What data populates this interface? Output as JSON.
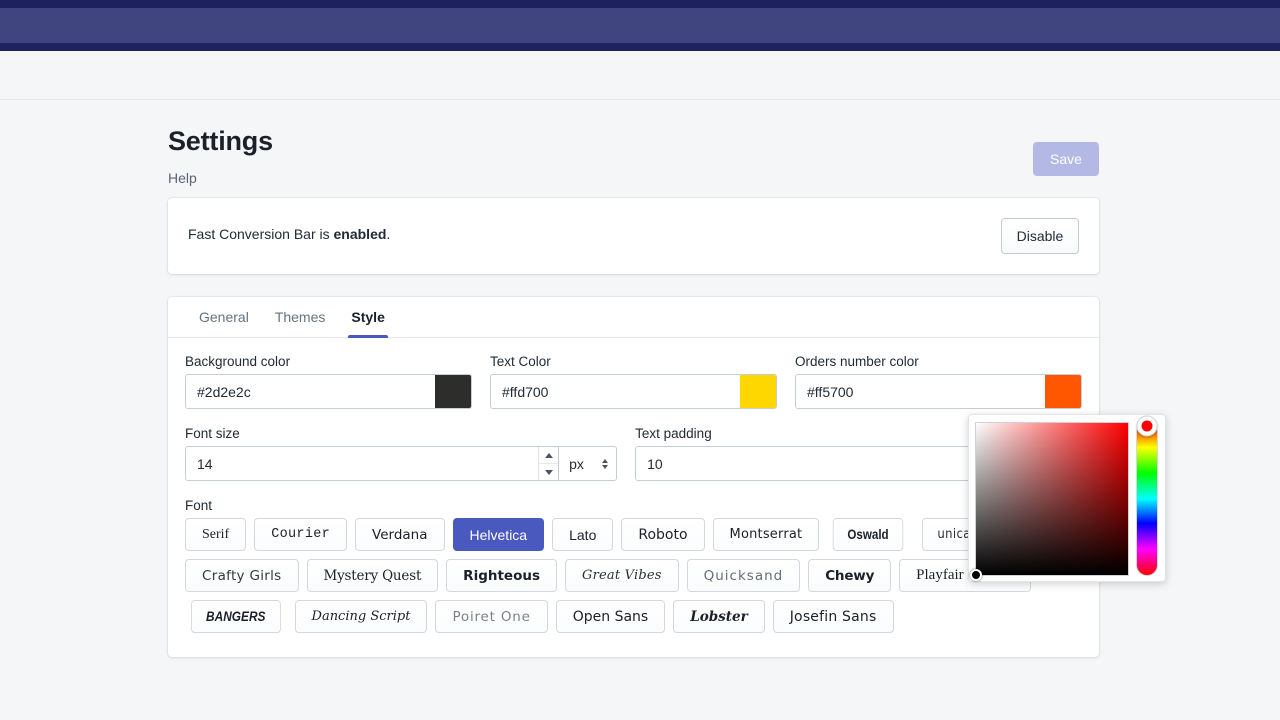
{
  "topbar": {
    "accent_dark": "#1f205e",
    "accent_main": "#40457f"
  },
  "page": {
    "title": "Settings",
    "help_link": "Help",
    "save_label": "Save",
    "save_color": "#b3b9e4"
  },
  "banner": {
    "text_prefix": "Fast Conversion Bar is ",
    "status": "enabled",
    "text_suffix": ".",
    "disable_label": "Disable"
  },
  "tabs": [
    {
      "label": "General",
      "active": false
    },
    {
      "label": "Themes",
      "active": false
    },
    {
      "label": "Style",
      "active": true
    }
  ],
  "tab_accent": "#4959bd",
  "style_form": {
    "background_color": {
      "label": "Background color",
      "value": "#2d2e2c",
      "swatch": "#2d2e2c"
    },
    "text_color": {
      "label": "Text Color",
      "value": "#ffd700",
      "swatch": "#ffd700"
    },
    "orders_number_color": {
      "label": "Orders number color",
      "value": "#ff5700",
      "swatch": "#ff5700"
    },
    "font_size": {
      "label": "Font size",
      "value": "14",
      "unit": "px"
    },
    "text_padding": {
      "label": "Text padding",
      "value": "10"
    },
    "font": {
      "label": "Font",
      "selected": "Helvetica",
      "options": [
        {
          "label": "Serif",
          "style": "f-serif",
          "selected": false
        },
        {
          "label": "Courier",
          "style": "f-courier",
          "selected": false
        },
        {
          "label": "Verdana",
          "style": "f-verdana",
          "selected": false
        },
        {
          "label": "Helvetica",
          "style": "f-helv",
          "selected": true
        },
        {
          "label": "Lato",
          "style": "f-lato",
          "selected": false
        },
        {
          "label": "Roboto",
          "style": "f-roboto",
          "selected": false
        },
        {
          "label": "Montserrat",
          "style": "f-montser",
          "selected": false
        },
        {
          "label": "Oswald",
          "style": "f-oswald",
          "selected": false
        },
        {
          "label": "unica one",
          "style": "f-unica",
          "selected": false
        },
        {
          "label": "Crafty Girls",
          "style": "f-crafty",
          "selected": false
        },
        {
          "label": "Mystery Quest",
          "style": "f-mystery",
          "selected": false
        },
        {
          "label": "Righteous",
          "style": "f-righteous",
          "selected": false
        },
        {
          "label": "Great Vibes",
          "style": "f-vibes",
          "selected": false
        },
        {
          "label": "Quicksand",
          "style": "f-quick",
          "selected": false
        },
        {
          "label": "Chewy",
          "style": "f-chewy",
          "selected": false
        },
        {
          "label": "Playfair Display",
          "style": "f-playfair",
          "selected": false
        },
        {
          "label": "BANGERS",
          "style": "f-bangers",
          "selected": false
        },
        {
          "label": "Dancing Script",
          "style": "f-dancing",
          "selected": false
        },
        {
          "label": "Poiret One",
          "style": "f-poiret",
          "selected": false
        },
        {
          "label": "Open Sans",
          "style": "f-opensans",
          "selected": false
        },
        {
          "label": "Lobster",
          "style": "f-lobster",
          "selected": false
        },
        {
          "label": "Josefin Sans",
          "style": "f-josefin",
          "selected": false
        }
      ]
    }
  },
  "color_picker": {
    "hue_color": "#ff0000",
    "selected_color": "#000000",
    "hue_position_pct": 2,
    "sv_position": {
      "saturation_pct": 0,
      "value_pct": 0
    }
  }
}
